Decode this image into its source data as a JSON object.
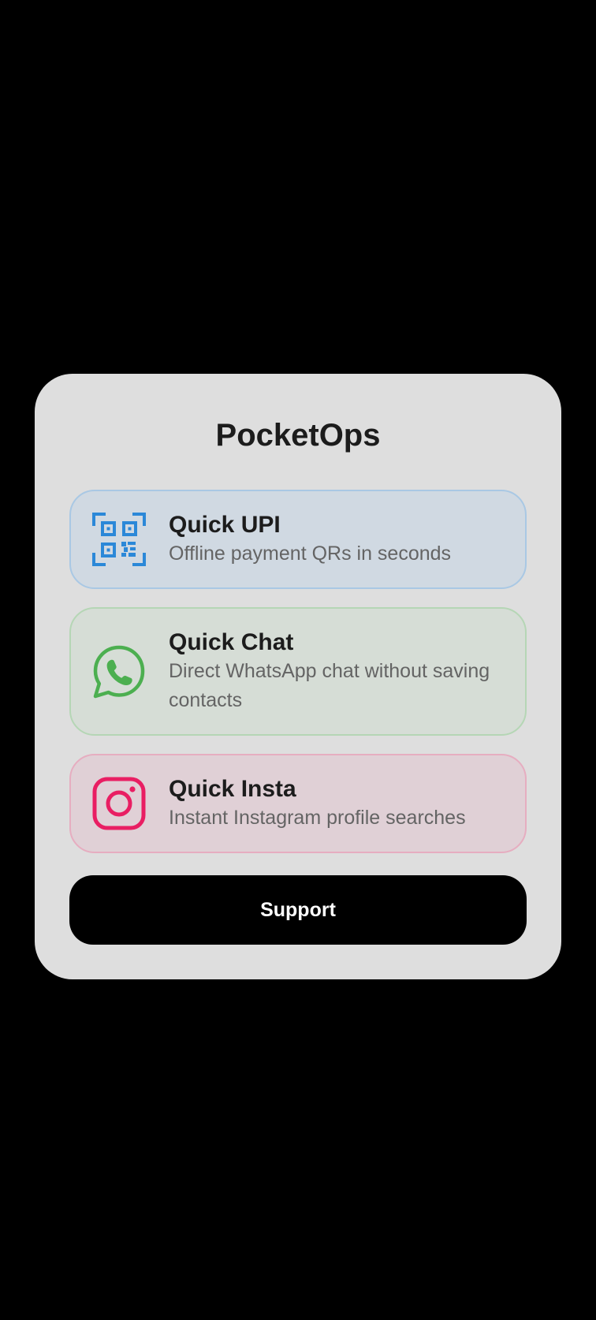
{
  "app": {
    "title": "PocketOps"
  },
  "tiles": [
    {
      "title": "Quick UPI",
      "subtitle": "Offline payment QRs in seconds",
      "icon": "qr-code-icon",
      "accent": "#2b88d8"
    },
    {
      "title": "Quick Chat",
      "subtitle": "Direct WhatsApp chat without saving contacts",
      "icon": "whatsapp-icon",
      "accent": "#4caf50"
    },
    {
      "title": "Quick Insta",
      "subtitle": "Instant Instagram profile searches",
      "icon": "instagram-icon",
      "accent": "#e91e63"
    }
  ],
  "support": {
    "label": "Support"
  }
}
